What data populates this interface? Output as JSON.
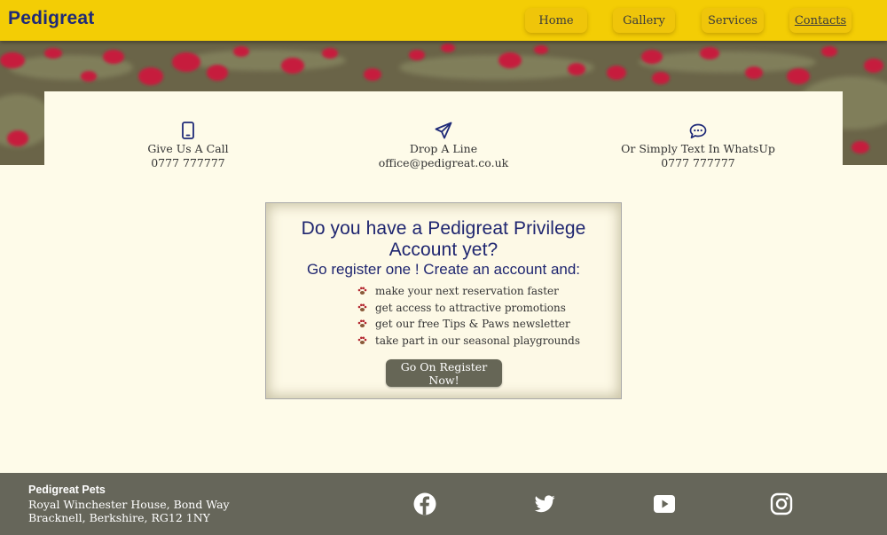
{
  "header": {
    "brand": "Pedigreat",
    "nav": [
      {
        "label": "Home"
      },
      {
        "label": "Gallery"
      },
      {
        "label": "Services"
      },
      {
        "label": "Contacts",
        "active": true
      }
    ],
    "colors": {
      "bar": "#f3cd05",
      "brand_text": "#1f2a78"
    }
  },
  "hero": {
    "image": "poppy-field-photo"
  },
  "contacts": [
    {
      "icon": "phone-icon",
      "label": "Give Us A Call",
      "value": "0777 777777"
    },
    {
      "icon": "paper-plane-icon",
      "label": "Drop A Line",
      "value": "office@pedigreat.co.uk"
    },
    {
      "icon": "chat-bubble-icon",
      "label": "Or Simply Text In WhatsUp",
      "value": "0777 777777"
    }
  ],
  "promo": {
    "title": "Do you have a Pedigreat Privilege Account yet?",
    "subtitle": "Go register one ! Create an account and:",
    "benefits": [
      "make your next reservation faster",
      "get access to attractive promotions",
      "get our free Tips & Paws newsletter",
      "take part in our seasonal playgrounds"
    ],
    "bullet_icon": "paw-icon",
    "cta": "Go On Register Now!"
  },
  "footer": {
    "company": "Pedigreat Pets",
    "address_line1": "Royal Winchester House, Bond Way",
    "address_line2": "Bracknell, Berkshire, RG12 1NY",
    "social": [
      "facebook-icon",
      "twitter-icon",
      "youtube-icon",
      "instagram-icon"
    ],
    "colors": {
      "bg": "#66665a"
    }
  }
}
